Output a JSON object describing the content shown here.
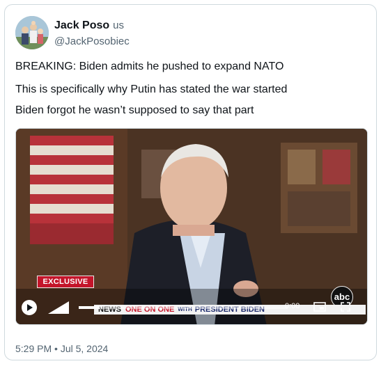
{
  "author": {
    "display_name": "Jack Poso",
    "flag": "us",
    "handle": "@JackPosobiec"
  },
  "post": {
    "lines": [
      "BREAKING: Biden admits he pushed to expand NATO",
      "This is specifically why Putin has stated the war started",
      "Biden forgot he wasn’t supposed to say that part"
    ],
    "timestamp": "5:29 PM • Jul 5, 2024"
  },
  "video": {
    "badge": "EXCLUSIVE",
    "network_logo": "abc",
    "lower_third": {
      "network": "NEWS",
      "show": "ONE ON ONE",
      "with": "WITH",
      "guest": "PRESIDENT BIDEN"
    },
    "time": "0:00",
    "progress": 0.1,
    "icons": [
      "play-icon",
      "volume-icon",
      "picture-in-picture-icon",
      "fullscreen-icon"
    ]
  },
  "colors": {
    "text": "#0f1419",
    "secondary": "#536471",
    "border": "#cfd9de",
    "badge_red": "#c4152a",
    "banner_navy": "#1c2a6b"
  }
}
